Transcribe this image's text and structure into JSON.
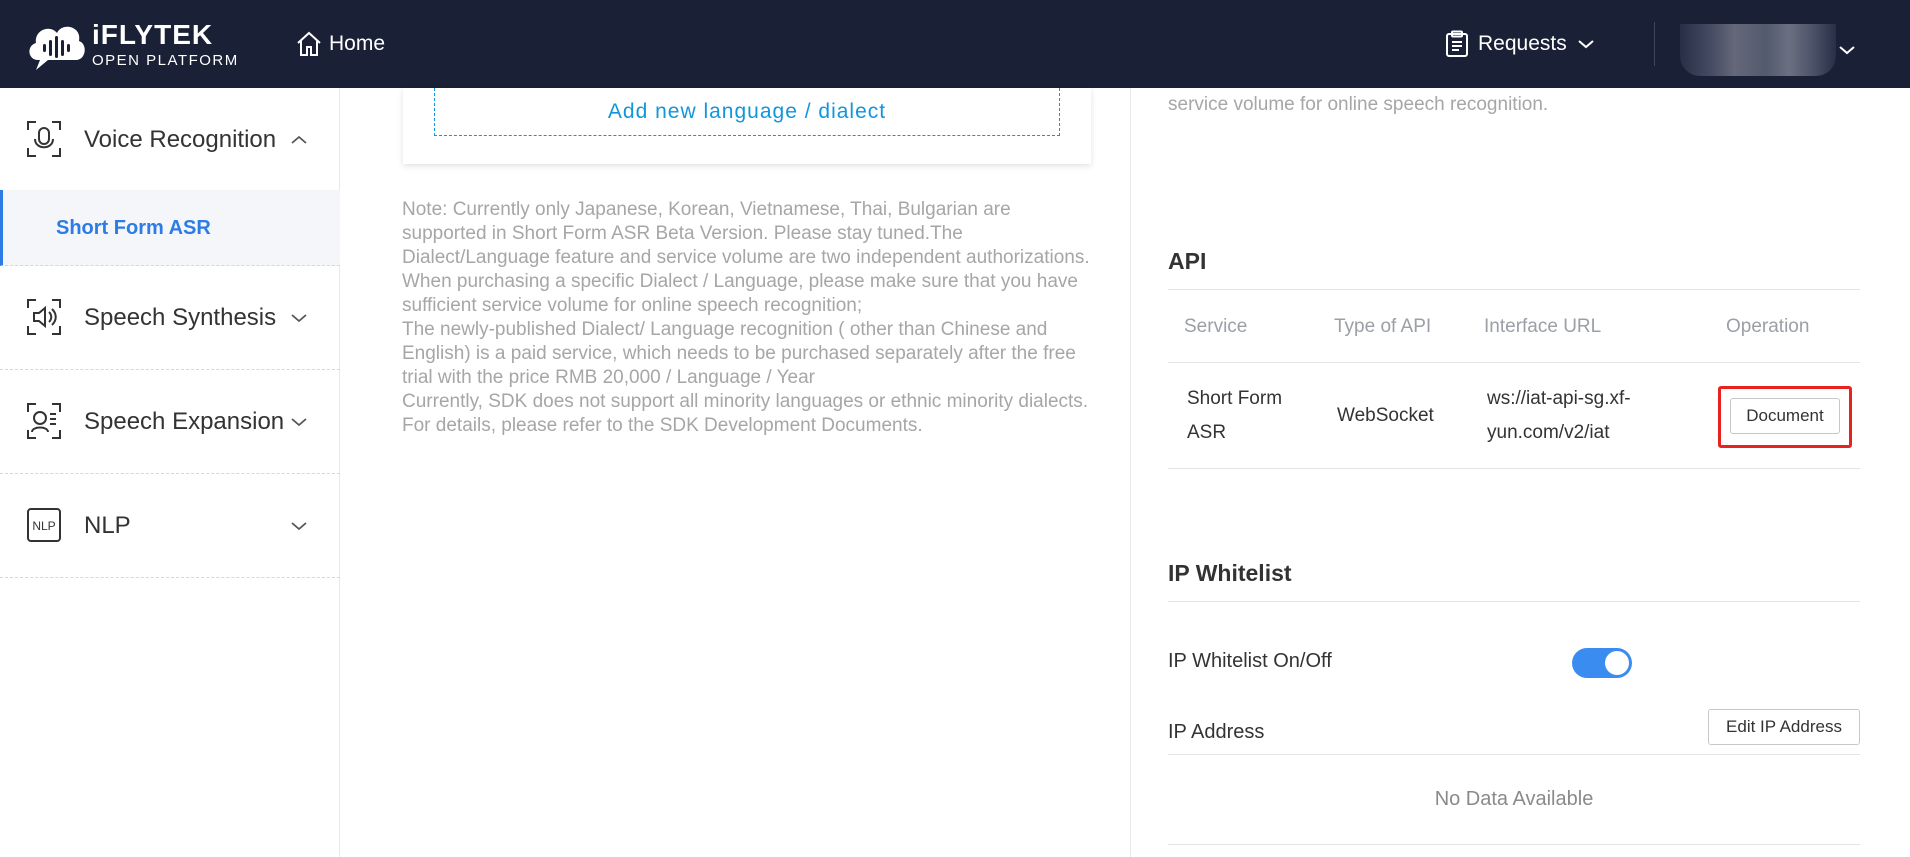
{
  "header": {
    "brand": "iFLYTEK",
    "brand_sub": "OPEN PLATFORM",
    "home_label": "Home",
    "requests_label": "Requests"
  },
  "sidebar": {
    "groups": [
      {
        "label": "Voice Recognition",
        "icon": "voice-recognition-icon",
        "expanded": true
      },
      {
        "label": "Speech Synthesis",
        "icon": "speech-synthesis-icon",
        "expanded": false
      },
      {
        "label": "Speech Expansion",
        "icon": "speech-expansion-icon",
        "expanded": false
      },
      {
        "label": "NLP",
        "icon": "nlp-icon",
        "expanded": false
      }
    ],
    "active_item": "Short Form ASR"
  },
  "language": {
    "add_label": "Add new language / dialect"
  },
  "note": {
    "paragraph_1": "Note: Currently only Japanese, Korean, Vietnamese, Thai, Bulgarian are supported in Short Form ASR Beta Version. Please stay tuned.The Dialect/Language feature and service volume are two independent authorizations. When purchasing a specific Dialect / Language, please make sure that you have sufficient service volume for online speech recognition;",
    "paragraph_2": "The newly-published Dialect/ Language recognition ( other than Chinese and English) is a paid service, which needs to be purchased separately after the free trial with the price RMB 20,000 / Language / Year",
    "paragraph_3": "Currently, SDK does not support all minority languages or ethnic minority dialects. For details, please refer to the SDK Development Documents."
  },
  "right_top_text": "service volume for online speech recognition.",
  "api": {
    "title": "API",
    "columns": [
      "Service",
      "Type of API",
      "Interface URL",
      "Operation"
    ],
    "rows": [
      {
        "service_line1": "Short Form",
        "service_line2": "ASR",
        "type": "WebSocket",
        "url_line1": "ws://iat-api-sg.xf-",
        "url_line2": "yun.com/v2/iat",
        "operation_label": "Document"
      }
    ]
  },
  "ip_whitelist": {
    "title": "IP Whitelist",
    "toggle_label": "IP Whitelist On/Off",
    "toggle_on": true,
    "address_label": "IP Address",
    "edit_label": "Edit IP Address",
    "empty_text": "No Data Available"
  },
  "colors": {
    "header_bg": "#1a2035",
    "accent": "#2d7be5",
    "link": "#1296db",
    "toggle_on": "#3b8cf0",
    "highlight": "#e8221e"
  }
}
